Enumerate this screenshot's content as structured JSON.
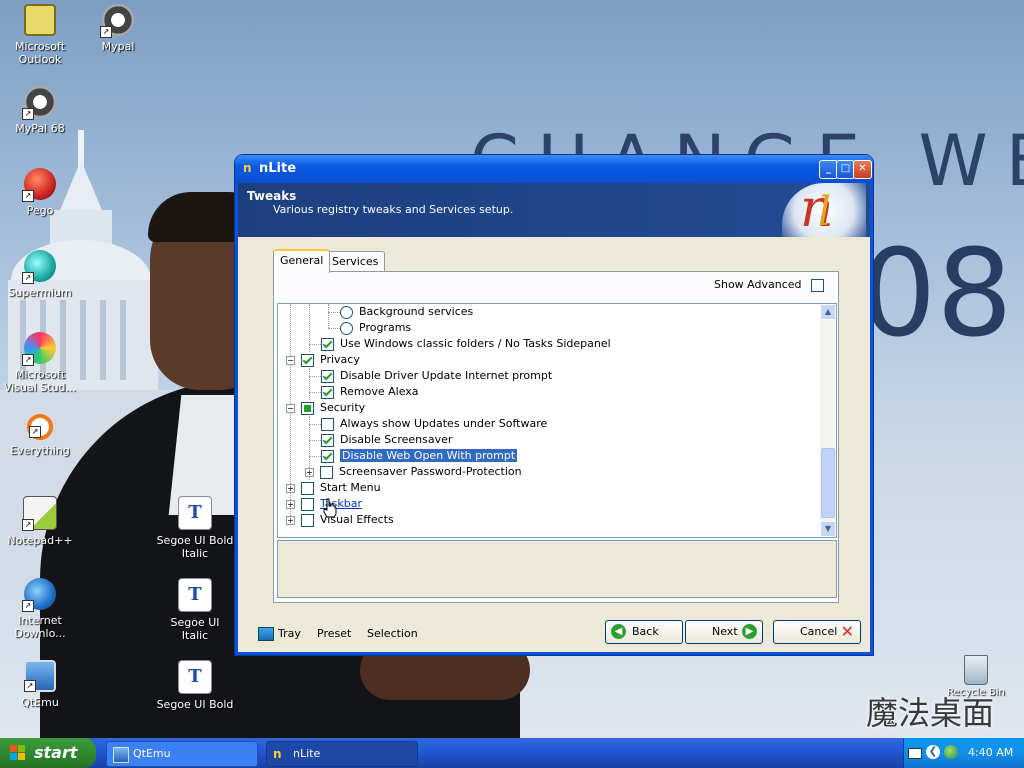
{
  "desktop": {
    "slogan": "CHANGE WE NEED",
    "year": "08",
    "icons": [
      {
        "label": "Microsoft Outlook"
      },
      {
        "label": "Mypal"
      },
      {
        "label": "MyPal 68"
      },
      {
        "label": "Pego"
      },
      {
        "label": "Supermium"
      },
      {
        "label": "Microsoft Visual Stud..."
      },
      {
        "label": "Everything"
      },
      {
        "label": "Notepad++"
      },
      {
        "label": "Internet Downlo..."
      },
      {
        "label": "QtEmu"
      },
      {
        "label": "Segoe UI Bold Italic"
      },
      {
        "label": "Segoe UI Italic"
      },
      {
        "label": "Segoe UI Bold"
      }
    ],
    "recycle_bin": "Recycle Bin",
    "watermark": "魔法桌面"
  },
  "window": {
    "title": "nLite",
    "header_title": "Tweaks",
    "header_subtitle": "Various registry tweaks and Services setup.",
    "tabs": [
      "General",
      "Services"
    ],
    "show_advanced": "Show Advanced",
    "tree": [
      {
        "label": "Background services",
        "kind": "radio"
      },
      {
        "label": "Programs",
        "kind": "radio"
      },
      {
        "label": "Use Windows classic folders / No Tasks Sidepanel",
        "kind": "checked"
      },
      {
        "label": "Privacy",
        "kind": "checked"
      },
      {
        "label": "Disable Driver Update Internet prompt",
        "kind": "checked"
      },
      {
        "label": "Remove Alexa",
        "kind": "checked"
      },
      {
        "label": "Security",
        "kind": "partial"
      },
      {
        "label": "Always show Updates under Software",
        "kind": "unchecked"
      },
      {
        "label": "Disable Screensaver",
        "kind": "checked"
      },
      {
        "label": "Disable Web Open With prompt",
        "kind": "checked",
        "selected": true
      },
      {
        "label": "Screensaver Password-Protection",
        "kind": "unchecked"
      },
      {
        "label": "Start Menu",
        "kind": "unchecked"
      },
      {
        "label": "Taskbar",
        "kind": "unchecked"
      },
      {
        "label": "Visual Effects",
        "kind": "unchecked"
      }
    ],
    "footer_links": [
      "Tray",
      "Preset",
      "Selection"
    ],
    "buttons": {
      "back": "Back",
      "next": "Next",
      "cancel": "Cancel"
    }
  },
  "taskbar": {
    "start": "start",
    "tasks": [
      "QtEmu",
      "nLite"
    ],
    "clock": "4:40 AM"
  }
}
